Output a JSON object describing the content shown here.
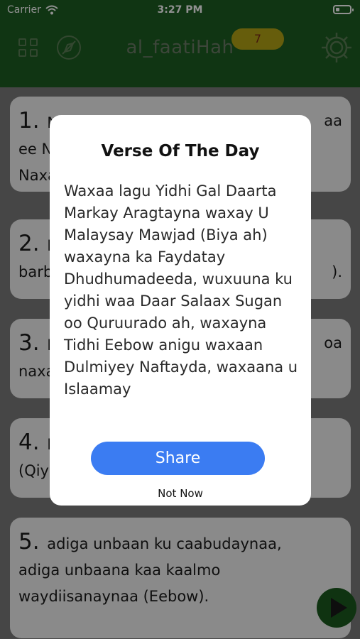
{
  "status_bar": {
    "carrier": "Carrier",
    "time": "3:27 PM",
    "battery_level": 0.2
  },
  "nav": {
    "title": "al_faatiHah",
    "badge_count": "7",
    "icons": [
      "grid-icon",
      "compass-icon",
      "gear-icon"
    ]
  },
  "verses": [
    {
      "number": "1.",
      "line1": "N",
      "line1_tail": "aa",
      "line2": "ee N",
      "line3": "Naxa"
    },
    {
      "number": "2.",
      "line1": "N",
      "line2": "barb",
      "line2_tail": ")."
    },
    {
      "number": "3.",
      "line1": "E",
      "line1_tail": "oa",
      "line2": "naxa"
    },
    {
      "number": "4.",
      "line1": "E",
      "line2": "(Qiy"
    },
    {
      "number": "5.",
      "line1": "adiga unbaan ku caabudaynaa,",
      "line2": "adiga unbaana kaa kaalmo",
      "line3": "waydiisanaynaa (Eebow)."
    }
  ],
  "modal": {
    "title": "Verse Of The Day",
    "body": "Waxaa lagu Yidhi Gal Daarta Markay Aragtayna waxay U Malaysay Mawjad (Biya ah) waxayna ka Faydatay Dhudhumadeeda, wuxuuna ku yidhi waa Daar Salaax Sugan oo Quruurado ah, waxayna Tidhi Eebow anigu waxaan Dulmiyey Naftayda, waxaana u Islaamay",
    "share_label": "Share",
    "dismiss_label": "Not Now"
  },
  "colors": {
    "header_green": "#1d5d22",
    "share_blue": "#3b7cf2",
    "badge_yellow": "#b3a416"
  }
}
